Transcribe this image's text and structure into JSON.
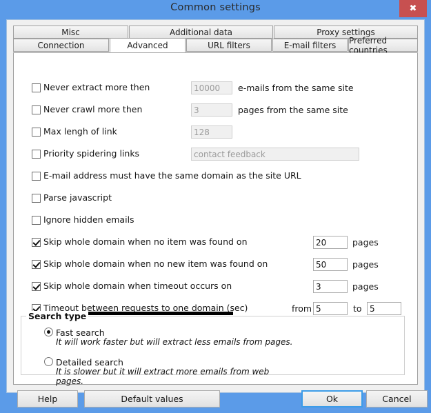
{
  "window": {
    "title": "Common settings",
    "close_icon": "close-icon",
    "close_label": "✖"
  },
  "tabs": {
    "row1": [
      {
        "label": "Misc",
        "selected": false
      },
      {
        "label": "Additional data",
        "selected": false
      },
      {
        "label": "Proxy settings",
        "selected": false
      }
    ],
    "row2": [
      {
        "label": "Connection",
        "selected": false
      },
      {
        "label": "Advanced",
        "selected": true
      },
      {
        "label": "URL filters",
        "selected": false
      },
      {
        "label": "E-mail filters",
        "selected": false
      },
      {
        "label": "Preferred countries",
        "selected": false
      }
    ]
  },
  "advanced": {
    "options": [
      {
        "label": "Never extract more then",
        "checked": false,
        "value": "10000",
        "enabled": false,
        "unit": "e-mails from the same site"
      },
      {
        "label": "Never crawl more then",
        "checked": false,
        "value": "3",
        "enabled": false,
        "unit": "pages from the same site"
      },
      {
        "label": "Max lengh of link",
        "checked": false,
        "value": "128",
        "enabled": false,
        "unit": ""
      },
      {
        "label": "Priority spidering links",
        "checked": false,
        "value": "contact feedback",
        "enabled": false,
        "unit": ""
      },
      {
        "label": "E-mail address must have the same domain as the site URL",
        "checked": false,
        "value": "",
        "enabled": false,
        "unit": ""
      },
      {
        "label": "Parse javascript",
        "checked": false,
        "value": "",
        "enabled": false,
        "unit": ""
      },
      {
        "label": "Ignore hidden emails",
        "checked": false,
        "value": "",
        "enabled": false,
        "unit": ""
      },
      {
        "label": "Skip whole domain when no item was found on",
        "checked": true,
        "value": "20",
        "enabled": true,
        "unit": "pages"
      },
      {
        "label": "Skip whole domain when no new item was found on",
        "checked": true,
        "value": "50",
        "enabled": true,
        "unit": "pages"
      },
      {
        "label": "Skip whole domain when timeout occurs on",
        "checked": true,
        "value": "3",
        "enabled": true,
        "unit": "pages"
      },
      {
        "label": "Timeout between requests to one domain (sec)",
        "checked": true,
        "value": "5",
        "enabled": true,
        "unit": ""
      }
    ],
    "timeout": {
      "from_label": "from",
      "from_value": "5",
      "to_label": "to",
      "to_value": "5"
    }
  },
  "search_type": {
    "legend": "Search type",
    "options": [
      {
        "label": "Fast search",
        "selected": true,
        "description": "It will work faster but will extract less emails from pages."
      },
      {
        "label": "Detailed search",
        "selected": false,
        "description": "It is slower but it will extract more emails from web\npages."
      }
    ]
  },
  "footer": {
    "help": "Help",
    "default_values": "Default values",
    "ok": "Ok",
    "cancel": "Cancel"
  },
  "colors": {
    "frame": "#5B9BE8",
    "close": "#C75050",
    "default_button_border": "#3C9CE8",
    "marker_bar": "#000000"
  }
}
